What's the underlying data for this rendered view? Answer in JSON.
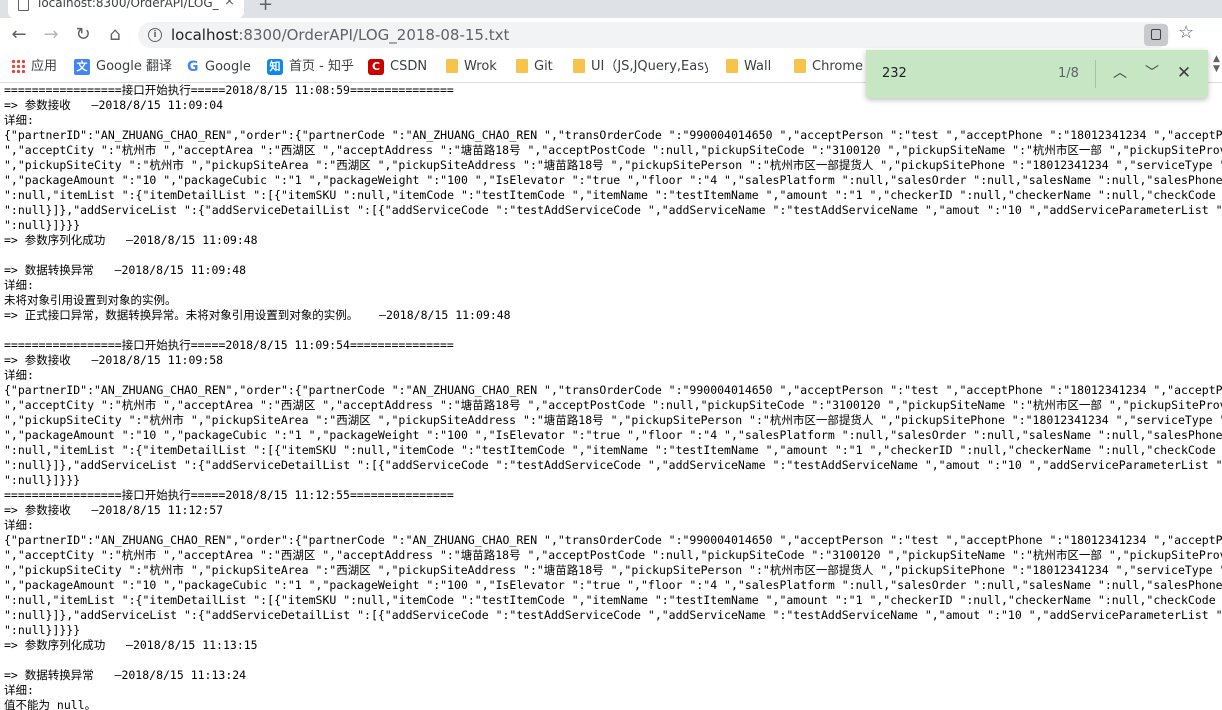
{
  "browser": {
    "tab_title": "localhost:8300/OrderAPI/LOG_",
    "tab_close": "×",
    "new_tab": "+",
    "url_host": "localhost",
    "url_rest": ":8300/OrderAPI/LOG_2018-08-15.txt",
    "star": "☆"
  },
  "bookmarks": [
    {
      "label": "应用",
      "icon": "apps-icon"
    },
    {
      "label": "Google 翻译",
      "icon": "google-translate-icon"
    },
    {
      "label": "Google",
      "icon": "google-icon"
    },
    {
      "label": "首页 - 知乎",
      "icon": "zhihu-icon"
    },
    {
      "label": "CSDN",
      "icon": "csdn-icon"
    },
    {
      "label": "Wrok",
      "icon": "folder-icon"
    },
    {
      "label": "Git",
      "icon": "folder-icon"
    },
    {
      "label": "UI（JS,JQuery,Easyu",
      "icon": "folder-icon"
    },
    {
      "label": "Wall",
      "icon": "folder-icon"
    },
    {
      "label": "Chrome",
      "icon": "folder-icon"
    }
  ],
  "find": {
    "query": "232",
    "count": "1/8"
  },
  "log_lines": [
    "=================接口开始执行=====2018/8/15 11:08:59===============",
    "=> 参数接收   —2018/8/15 11:09:04",
    "详细:",
    "{\"partnerID\":\"AN_ZHUANG_CHAO_REN\",\"order\":{\"partnerCode \":\"AN_ZHUANG_CHAO_REN \",\"transOrderCode \":\"990004014650 \",\"acceptPerson \":\"test \",\"acceptPhone \":\"18012341234 \",\"acceptProvince \":\"",
    "\",\"acceptCity \":\"杭州市 \",\"acceptArea \":\"西湖区 \",\"acceptAddress \":\"塘苗路18号 \",\"acceptPostCode \":null,\"pickupSiteCode \":\"3100120 \",\"pickupSiteName \":\"杭州市区一部 \",\"pickupSiteProvince",
    "\",\"pickupSiteCity \":\"杭州市 \",\"pickupSiteArea \":\"西湖区 \",\"pickupSiteAddress \":\"塘苗路18号 \",\"pickupSitePerson \":\"杭州市区一部提货人 \",\"pickupSitePhone \":\"18012341234 \",\"serviceType \":\"送",
    "\",\"packageAmount \":\"10 \",\"packageCubic \":\"1 \",\"packageWeight \":\"100 \",\"IsElevator \":\"true \",\"floor \":\"4 \",\"salesPlatform \":null,\"salesOrder \":null,\"salesName \":null,\"salesPhone \":null,\"re",
    "\":null,\"itemList \":{\"itemDetailList \":[{\"itemSKU \":null,\"itemCode \":\"testItemCode \",\"itemName \":\"testItemName \",\"amount \":\"1 \",\"checkerID \":null,\"checkerName \":null,\"checkCode \":null,\"rem",
    "\":null}]},\"addServiceList \":{\"addServiceDetailList \":[{\"addServiceCode \":\"testAddServiceCode \",\"addServiceName \":\"testAddServiceName \",\"amout \":\"10 \",\"addServiceParameterList \":null,\"rema",
    "\":null}]}}}",
    "=> 参数序列化成功   —2018/8/15 11:09:48",
    "",
    "=> 数据转换异常   —2018/8/15 11:09:48",
    "详细:",
    "未将对象引用设置到对象的实例。",
    "=> 正式接口异常，数据转换异常。未将对象引用设置到对象的实例。   —2018/8/15 11:09:48",
    "",
    "=================接口开始执行=====2018/8/15 11:09:54===============",
    "=> 参数接收   —2018/8/15 11:09:58",
    "详细:",
    "{\"partnerID\":\"AN_ZHUANG_CHAO_REN\",\"order\":{\"partnerCode \":\"AN_ZHUANG_CHAO_REN \",\"transOrderCode \":\"990004014650 \",\"acceptPerson \":\"test \",\"acceptPhone \":\"18012341234 \",\"acceptProvince \":\"",
    "\",\"acceptCity \":\"杭州市 \",\"acceptArea \":\"西湖区 \",\"acceptAddress \":\"塘苗路18号 \",\"acceptPostCode \":null,\"pickupSiteCode \":\"3100120 \",\"pickupSiteName \":\"杭州市区一部 \",\"pickupSiteProvince",
    "\",\"pickupSiteCity \":\"杭州市 \",\"pickupSiteArea \":\"西湖区 \",\"pickupSiteAddress \":\"塘苗路18号 \",\"pickupSitePerson \":\"杭州市区一部提货人 \",\"pickupSitePhone \":\"18012341234 \",\"serviceType \":\"送",
    "\",\"packageAmount \":\"10 \",\"packageCubic \":\"1 \",\"packageWeight \":\"100 \",\"IsElevator \":\"true \",\"floor \":\"4 \",\"salesPlatform \":null,\"salesOrder \":null,\"salesName \":null,\"salesPhone \":null,\"re",
    "\":null,\"itemList \":{\"itemDetailList \":[{\"itemSKU \":null,\"itemCode \":\"testItemCode \",\"itemName \":\"testItemName \",\"amount \":\"1 \",\"checkerID \":null,\"checkerName \":null,\"checkCode \":null,\"rem",
    "\":null}]},\"addServiceList \":{\"addServiceDetailList \":[{\"addServiceCode \":\"testAddServiceCode \",\"addServiceName \":\"testAddServiceName \",\"amout \":\"10 \",\"addServiceParameterList \":null,\"rema",
    "\":null}]}}}",
    "=================接口开始执行=====2018/8/15 11:12:55===============",
    "=> 参数接收   —2018/8/15 11:12:57",
    "详细:",
    "{\"partnerID\":\"AN_ZHUANG_CHAO_REN\",\"order\":{\"partnerCode \":\"AN_ZHUANG_CHAO_REN \",\"transOrderCode \":\"990004014650 \",\"acceptPerson \":\"test \",\"acceptPhone \":\"18012341234 \",\"acceptProvince \":\"",
    "\",\"acceptCity \":\"杭州市 \",\"acceptArea \":\"西湖区 \",\"acceptAddress \":\"塘苗路18号 \",\"acceptPostCode \":null,\"pickupSiteCode \":\"3100120 \",\"pickupSiteName \":\"杭州市区一部 \",\"pickupSiteProvince",
    "\",\"pickupSiteCity \":\"杭州市 \",\"pickupSiteArea \":\"西湖区 \",\"pickupSiteAddress \":\"塘苗路18号 \",\"pickupSitePerson \":\"杭州市区一部提货人 \",\"pickupSitePhone \":\"18012341234 \",\"serviceType \":\"送",
    "\",\"packageAmount \":\"10 \",\"packageCubic \":\"1 \",\"packageWeight \":\"100 \",\"IsElevator \":\"true \",\"floor \":\"4 \",\"salesPlatform \":null,\"salesOrder \":null,\"salesName \":null,\"salesPhone \":null,\"re",
    "\":null,\"itemList \":{\"itemDetailList \":[{\"itemSKU \":null,\"itemCode \":\"testItemCode \",\"itemName \":\"testItemName \",\"amount \":\"1 \",\"checkerID \":null,\"checkerName \":null,\"checkCode \":null,\"rem",
    "\":null}]},\"addServiceList \":{\"addServiceDetailList \":[{\"addServiceCode \":\"testAddServiceCode \",\"addServiceName \":\"testAddServiceName \",\"amout \":\"10 \",\"addServiceParameterList \":null,\"rema",
    "\":null}]}}}",
    "=> 参数序列化成功   —2018/8/15 11:13:15",
    "",
    "=> 数据转换异常   —2018/8/15 11:13:24",
    "详细:",
    "值不能为 null。"
  ]
}
